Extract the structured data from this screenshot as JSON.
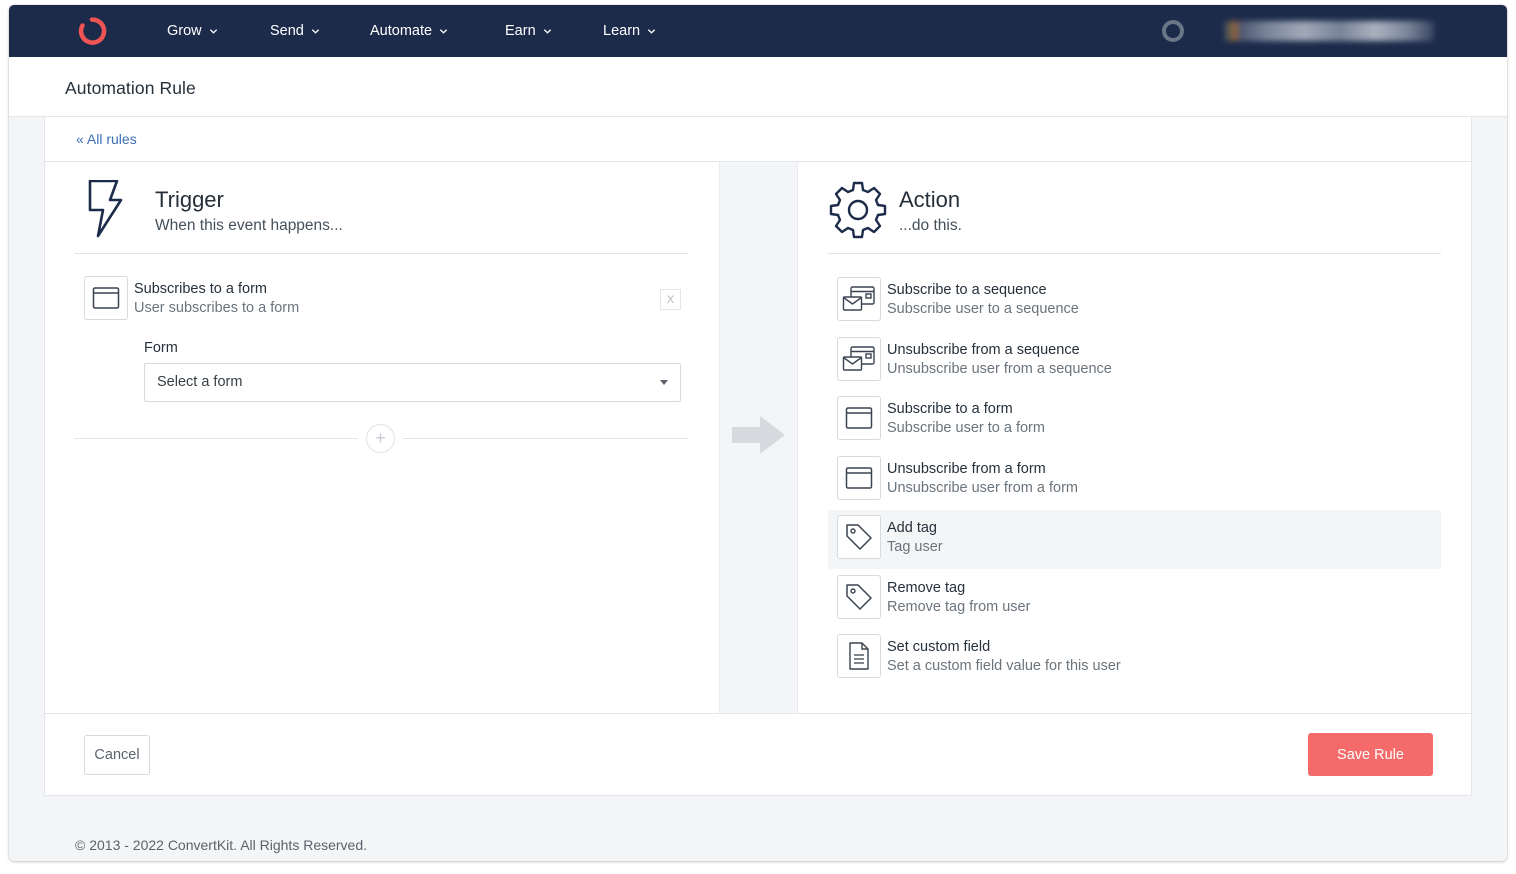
{
  "nav": {
    "items": [
      {
        "label": "Grow"
      },
      {
        "label": "Send"
      },
      {
        "label": "Automate"
      },
      {
        "label": "Earn"
      },
      {
        "label": "Learn"
      }
    ]
  },
  "page": {
    "title": "Automation Rule",
    "back_link": "« All rules"
  },
  "trigger": {
    "title": "Trigger",
    "subtitle": "When this event happens...",
    "item": {
      "title": "Subscribes to a form",
      "subtitle": "User subscribes to a form",
      "remove_label": "X"
    },
    "form_label": "Form",
    "form_select_value": "Select a form",
    "add_label": "+"
  },
  "action": {
    "title": "Action",
    "subtitle": "...do this.",
    "items": [
      {
        "title": "Subscribe to a sequence",
        "subtitle": "Subscribe user to a sequence",
        "icon": "sequence-icon"
      },
      {
        "title": "Unsubscribe from a sequence",
        "subtitle": "Unsubscribe user from a sequence",
        "icon": "sequence-icon"
      },
      {
        "title": "Subscribe to a form",
        "subtitle": "Subscribe user to a form",
        "icon": "form-icon"
      },
      {
        "title": "Unsubscribe from a form",
        "subtitle": "Unsubscribe user from a form",
        "icon": "form-icon"
      },
      {
        "title": "Add tag",
        "subtitle": "Tag user",
        "icon": "tag-icon",
        "highlighted": true
      },
      {
        "title": "Remove tag",
        "subtitle": "Remove tag from user",
        "icon": "tag-icon"
      },
      {
        "title": "Set custom field",
        "subtitle": "Set a custom field value for this user",
        "icon": "document-icon"
      }
    ]
  },
  "buttons": {
    "cancel": "Cancel",
    "save": "Save Rule"
  },
  "footer": {
    "copyright": "© 2013 - 2022 ConvertKit. All Rights Reserved."
  },
  "colors": {
    "nav_bg": "#1d2b4b",
    "brand_red": "#f56b6b",
    "link_blue": "#3b6fb6"
  }
}
